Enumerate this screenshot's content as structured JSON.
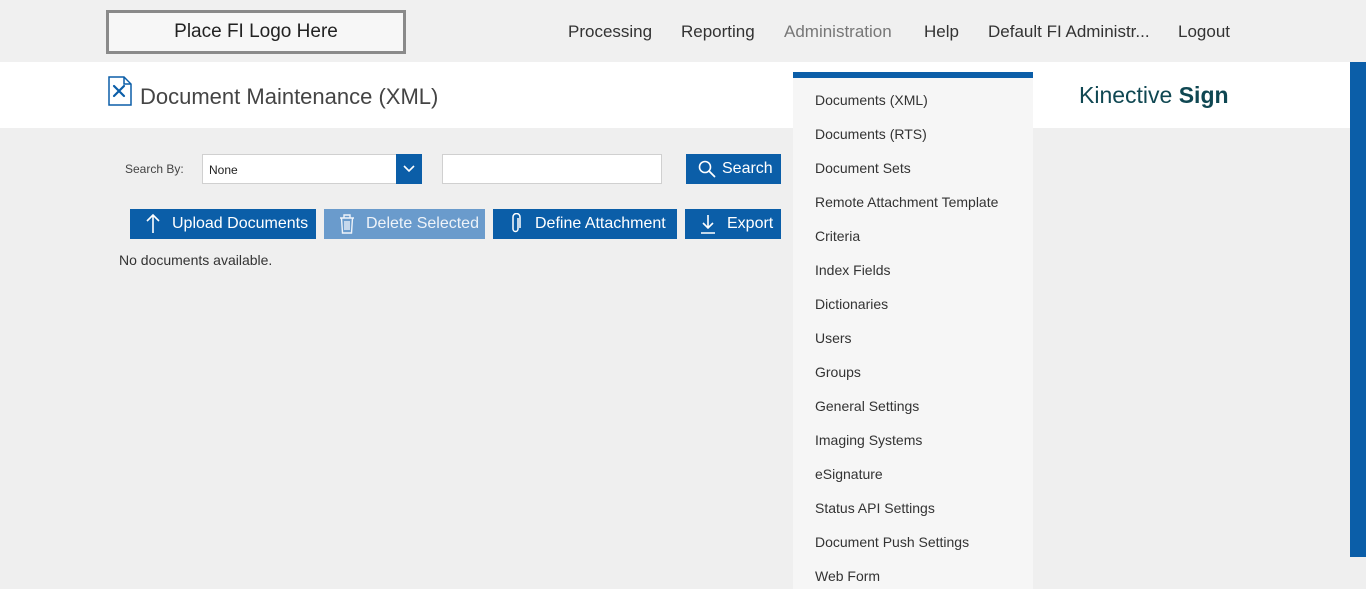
{
  "topbar": {
    "logo_text": "Place FI Logo Here",
    "nav": {
      "processing": "Processing",
      "reporting": "Reporting",
      "administration": "Administration",
      "help": "Help",
      "user": "Default FI Administr...",
      "logout": "Logout"
    }
  },
  "header": {
    "page_title": "Document Maintenance (XML)",
    "brand_light": "Kinective ",
    "brand_bold": "Sign"
  },
  "search": {
    "label": "Search By:",
    "selected_option": "None",
    "input_value": "",
    "button_label": "Search"
  },
  "toolbar": {
    "upload_label": "Upload Documents",
    "delete_label": "Delete Selected",
    "define_label": "Define Attachment",
    "export_label": "Export"
  },
  "content": {
    "empty_message": "No documents available."
  },
  "admin_menu": {
    "items": [
      "Documents (XML)",
      "Documents (RTS)",
      "Document Sets",
      "Remote Attachment Template",
      "Criteria",
      "Index Fields",
      "Dictionaries",
      "Users",
      "Groups",
      "General Settings",
      "Imaging Systems",
      "eSignature",
      "Status API Settings",
      "Document Push Settings",
      "Web Form"
    ]
  },
  "colors": {
    "accent": "#0b5ea8",
    "accent_disabled": "#6a9bcc",
    "brand_text": "#0f4752",
    "page_bg": "#efefef"
  }
}
